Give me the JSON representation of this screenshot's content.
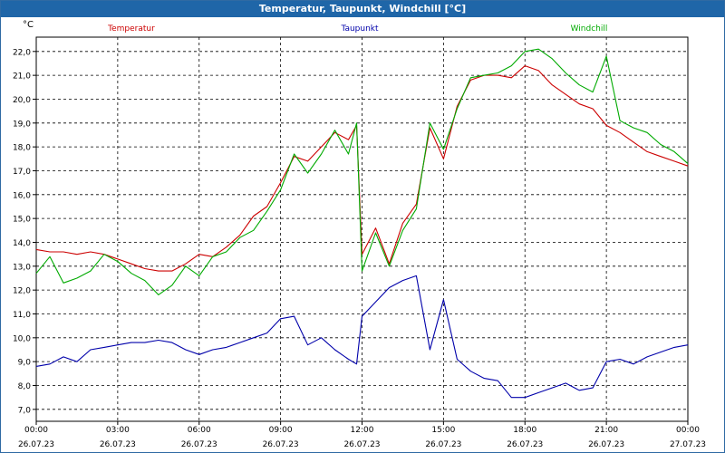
{
  "window": {
    "title": "Temperatur, Taupunkt, Windchill [°C]"
  },
  "chart_data": {
    "type": "line",
    "title": "Temperatur, Taupunkt, Windchill [°C]",
    "ylabel": "°C",
    "xlabel": "",
    "ylim": [
      6.5,
      22.6
    ],
    "grid": true,
    "legend_placement": "top",
    "x_ticks": [
      {
        "time": "00:00",
        "date": "26.07.23"
      },
      {
        "time": "03:00",
        "date": "26.07.23"
      },
      {
        "time": "06:00",
        "date": "26.07.23"
      },
      {
        "time": "09:00",
        "date": "26.07.23"
      },
      {
        "time": "12:00",
        "date": "26.07.23"
      },
      {
        "time": "15:00",
        "date": "26.07.23"
      },
      {
        "time": "18:00",
        "date": "26.07.23"
      },
      {
        "time": "21:00",
        "date": "26.07.23"
      },
      {
        "time": "00:00",
        "date": "27.07.23"
      }
    ],
    "y_ticks": [
      "7,0",
      "8,0",
      "9,0",
      "10,0",
      "11,0",
      "12,0",
      "13,0",
      "14,0",
      "15,0",
      "16,0",
      "17,0",
      "18,0",
      "19,0",
      "20,0",
      "21,0",
      "22,0"
    ],
    "y_tick_values": [
      7,
      8,
      9,
      10,
      11,
      12,
      13,
      14,
      15,
      16,
      17,
      18,
      19,
      20,
      21,
      22
    ],
    "x_hours": [
      0,
      0.5,
      1,
      1.5,
      2,
      2.5,
      3,
      3.5,
      4,
      4.5,
      5,
      5.5,
      6,
      6.5,
      7,
      7.5,
      8,
      8.5,
      9,
      9.5,
      10,
      10.5,
      11,
      11.5,
      11.8,
      12,
      12.5,
      13,
      13.5,
      14,
      14.5,
      15,
      15.5,
      16,
      16.5,
      17,
      17.5,
      18,
      18.5,
      19,
      19.5,
      20,
      20.5,
      21,
      21.5,
      22,
      22.5,
      23,
      23.5,
      24
    ],
    "series": [
      {
        "name": "Temperatur",
        "color": "#cc0000",
        "values": [
          13.7,
          13.6,
          13.6,
          13.5,
          13.6,
          13.5,
          13.3,
          13.1,
          12.9,
          12.8,
          12.8,
          13.1,
          13.5,
          13.4,
          13.8,
          14.3,
          15.1,
          15.5,
          16.5,
          17.6,
          17.4,
          18.0,
          18.6,
          18.3,
          18.9,
          13.5,
          14.6,
          13.1,
          14.8,
          15.6,
          18.8,
          17.5,
          19.7,
          20.8,
          21.0,
          21.0,
          20.9,
          21.4,
          21.2,
          20.6,
          20.2,
          19.8,
          19.6,
          18.9,
          18.6,
          18.2,
          17.8,
          17.6,
          17.4,
          17.2
        ]
      },
      {
        "name": "Taupunkt",
        "color": "#0000aa",
        "values": [
          8.8,
          8.9,
          9.2,
          9.0,
          9.5,
          9.6,
          9.7,
          9.8,
          9.8,
          9.9,
          9.8,
          9.5,
          9.3,
          9.5,
          9.6,
          9.8,
          10.0,
          10.2,
          10.8,
          10.9,
          9.7,
          10.0,
          9.5,
          9.1,
          8.9,
          10.9,
          11.5,
          12.1,
          12.4,
          12.6,
          9.5,
          11.6,
          9.1,
          8.6,
          8.3,
          8.2,
          7.5,
          7.5,
          7.7,
          7.9,
          8.1,
          7.8,
          7.9,
          9.0,
          9.1,
          8.9,
          9.2,
          9.4,
          9.6,
          9.7
        ]
      },
      {
        "name": "Windchill",
        "color": "#00aa00",
        "values": [
          12.7,
          13.4,
          12.3,
          12.5,
          12.8,
          13.5,
          13.2,
          12.7,
          12.4,
          11.8,
          12.2,
          13.0,
          12.6,
          13.4,
          13.6,
          14.2,
          14.5,
          15.3,
          16.2,
          17.7,
          16.9,
          17.7,
          18.7,
          17.7,
          19.0,
          12.8,
          14.4,
          13.0,
          14.5,
          15.4,
          19.0,
          17.9,
          19.6,
          20.9,
          21.0,
          21.1,
          21.4,
          22.0,
          22.1,
          21.7,
          21.1,
          20.6,
          20.3,
          21.8,
          19.1,
          18.8,
          18.6,
          18.1,
          17.8,
          17.3
        ]
      }
    ]
  }
}
